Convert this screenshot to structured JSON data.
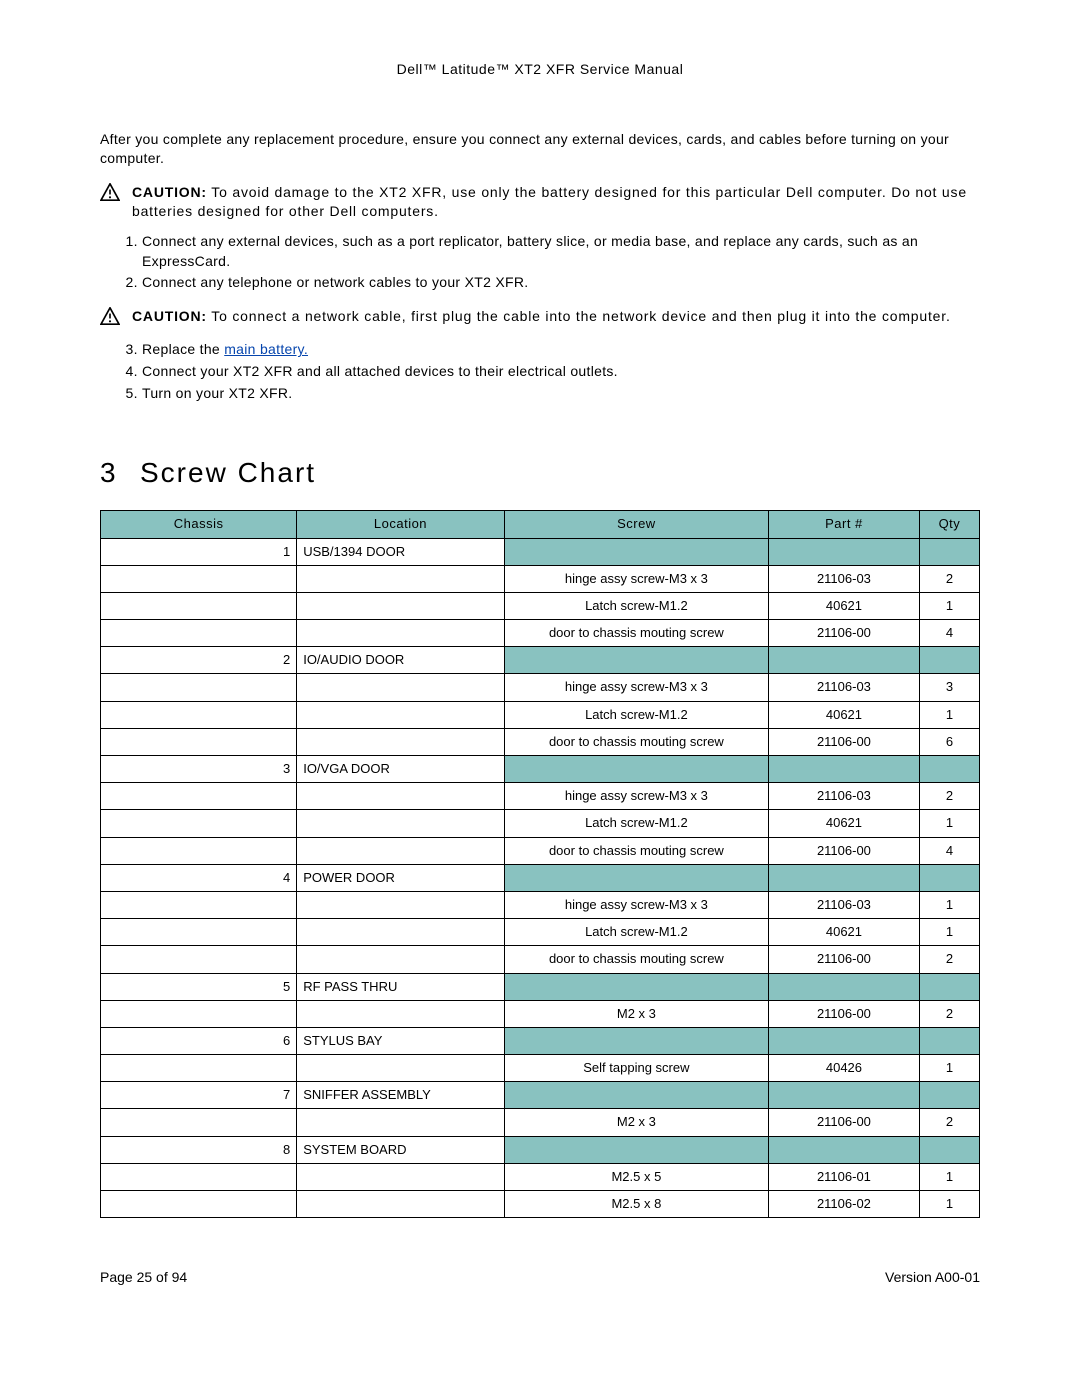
{
  "header": {
    "title": "Dell™ Latitude™ XT2 XFR Service Manual"
  },
  "intro": "After you complete any replacement procedure, ensure you connect any external devices, cards, and cables before turning on your computer.",
  "caution1": {
    "label": "CAUTION:",
    "text": " To avoid damage to the XT2 XFR, use only the battery designed for this particular Dell computer. Do not use batteries designed for other Dell computers."
  },
  "steps1": [
    "Connect any external devices, such as a port replicator, battery slice, or media base, and replace any cards, such as an ExpressCard.",
    "Connect any telephone or network cables to your XT2 XFR."
  ],
  "caution2": {
    "label": "CAUTION:",
    "text": " To connect a network cable, first plug the cable into the network device and then plug it into the computer."
  },
  "steps2": {
    "s3_prefix": "Replace the ",
    "s3_link": "main battery.",
    "s4": "Connect your XT2 XFR and all attached devices to their electrical outlets.",
    "s5": "Turn on your XT2 XFR."
  },
  "section": {
    "num": "3",
    "title": "Screw Chart"
  },
  "table": {
    "headers": {
      "chassis": "Chassis",
      "location": "Location",
      "screw": "Screw",
      "part": "Part #",
      "qty": "Qty"
    },
    "rows": [
      {
        "type": "group",
        "chassis": "1",
        "location": "USB/1394 DOOR"
      },
      {
        "type": "item",
        "screw": "hinge assy screw-M3 x 3",
        "part": "21106-03",
        "qty": "2"
      },
      {
        "type": "item",
        "screw": "Latch screw-M1.2",
        "part": "40621",
        "qty": "1"
      },
      {
        "type": "item",
        "screw": "door to chassis mouting screw",
        "part": "21106-00",
        "qty": "4"
      },
      {
        "type": "group",
        "chassis": "2",
        "location": "IO/AUDIO DOOR"
      },
      {
        "type": "item",
        "screw": "hinge assy screw-M3 x 3",
        "part": "21106-03",
        "qty": "3"
      },
      {
        "type": "item",
        "screw": "Latch screw-M1.2",
        "part": "40621",
        "qty": "1"
      },
      {
        "type": "item",
        "screw": "door to chassis mouting screw",
        "part": "21106-00",
        "qty": "6"
      },
      {
        "type": "group",
        "chassis": "3",
        "location": "IO/VGA DOOR"
      },
      {
        "type": "item",
        "screw": "hinge assy screw-M3 x 3",
        "part": "21106-03",
        "qty": "2"
      },
      {
        "type": "item",
        "screw": "Latch screw-M1.2",
        "part": "40621",
        "qty": "1"
      },
      {
        "type": "item",
        "screw": "door to chassis mouting screw",
        "part": "21106-00",
        "qty": "4"
      },
      {
        "type": "group",
        "chassis": "4",
        "location": "POWER DOOR"
      },
      {
        "type": "item",
        "screw": "hinge assy screw-M3 x 3",
        "part": "21106-03",
        "qty": "1"
      },
      {
        "type": "item",
        "screw": "Latch screw-M1.2",
        "part": "40621",
        "qty": "1"
      },
      {
        "type": "item",
        "screw": "door to chassis mouting screw",
        "part": "21106-00",
        "qty": "2"
      },
      {
        "type": "group",
        "chassis": "5",
        "location": "RF PASS THRU"
      },
      {
        "type": "item",
        "screw": "M2 x 3",
        "part": "21106-00",
        "qty": "2"
      },
      {
        "type": "group",
        "chassis": "6",
        "location": "STYLUS BAY"
      },
      {
        "type": "item",
        "screw": "Self tapping screw",
        "part": "40426",
        "qty": "1"
      },
      {
        "type": "group",
        "chassis": "7",
        "location": "SNIFFER ASSEMBLY"
      },
      {
        "type": "item",
        "screw": "M2 x 3",
        "part": "21106-00",
        "qty": "2"
      },
      {
        "type": "group",
        "chassis": "8",
        "location": "SYSTEM BOARD"
      },
      {
        "type": "item",
        "screw": "M2.5 x 5",
        "part": "21106-01",
        "qty": "1"
      },
      {
        "type": "item",
        "screw": "M2.5 x 8",
        "part": "21106-02",
        "qty": "1"
      }
    ]
  },
  "footer": {
    "page": "Page 25 of 94",
    "version": "Version A00-01"
  }
}
